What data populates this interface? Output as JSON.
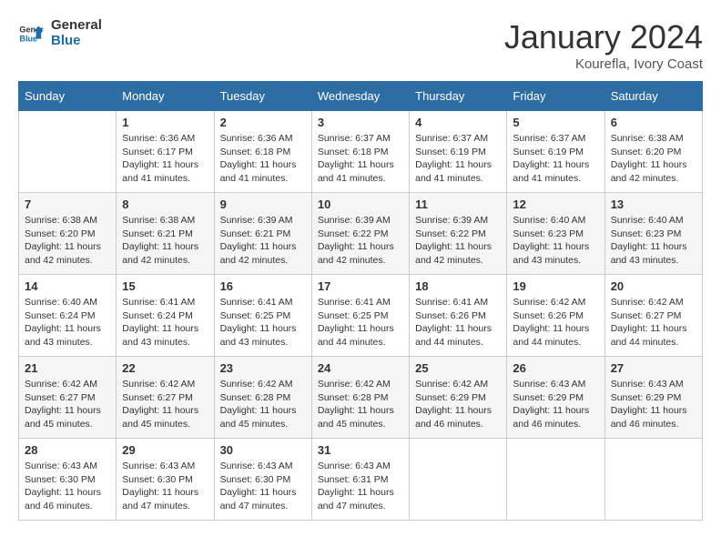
{
  "header": {
    "logo": "GeneralBlue",
    "month": "January 2024",
    "location": "Kourefla, Ivory Coast"
  },
  "days_of_week": [
    "Sunday",
    "Monday",
    "Tuesday",
    "Wednesday",
    "Thursday",
    "Friday",
    "Saturday"
  ],
  "weeks": [
    [
      {
        "day": "",
        "info": ""
      },
      {
        "day": "1",
        "info": "Sunrise: 6:36 AM\nSunset: 6:17 PM\nDaylight: 11 hours and 41 minutes."
      },
      {
        "day": "2",
        "info": "Sunrise: 6:36 AM\nSunset: 6:18 PM\nDaylight: 11 hours and 41 minutes."
      },
      {
        "day": "3",
        "info": "Sunrise: 6:37 AM\nSunset: 6:18 PM\nDaylight: 11 hours and 41 minutes."
      },
      {
        "day": "4",
        "info": "Sunrise: 6:37 AM\nSunset: 6:19 PM\nDaylight: 11 hours and 41 minutes."
      },
      {
        "day": "5",
        "info": "Sunrise: 6:37 AM\nSunset: 6:19 PM\nDaylight: 11 hours and 41 minutes."
      },
      {
        "day": "6",
        "info": "Sunrise: 6:38 AM\nSunset: 6:20 PM\nDaylight: 11 hours and 42 minutes."
      }
    ],
    [
      {
        "day": "7",
        "info": "Sunrise: 6:38 AM\nSunset: 6:20 PM\nDaylight: 11 hours and 42 minutes."
      },
      {
        "day": "8",
        "info": "Sunrise: 6:38 AM\nSunset: 6:21 PM\nDaylight: 11 hours and 42 minutes."
      },
      {
        "day": "9",
        "info": "Sunrise: 6:39 AM\nSunset: 6:21 PM\nDaylight: 11 hours and 42 minutes."
      },
      {
        "day": "10",
        "info": "Sunrise: 6:39 AM\nSunset: 6:22 PM\nDaylight: 11 hours and 42 minutes."
      },
      {
        "day": "11",
        "info": "Sunrise: 6:39 AM\nSunset: 6:22 PM\nDaylight: 11 hours and 42 minutes."
      },
      {
        "day": "12",
        "info": "Sunrise: 6:40 AM\nSunset: 6:23 PM\nDaylight: 11 hours and 43 minutes."
      },
      {
        "day": "13",
        "info": "Sunrise: 6:40 AM\nSunset: 6:23 PM\nDaylight: 11 hours and 43 minutes."
      }
    ],
    [
      {
        "day": "14",
        "info": "Sunrise: 6:40 AM\nSunset: 6:24 PM\nDaylight: 11 hours and 43 minutes."
      },
      {
        "day": "15",
        "info": "Sunrise: 6:41 AM\nSunset: 6:24 PM\nDaylight: 11 hours and 43 minutes."
      },
      {
        "day": "16",
        "info": "Sunrise: 6:41 AM\nSunset: 6:25 PM\nDaylight: 11 hours and 43 minutes."
      },
      {
        "day": "17",
        "info": "Sunrise: 6:41 AM\nSunset: 6:25 PM\nDaylight: 11 hours and 44 minutes."
      },
      {
        "day": "18",
        "info": "Sunrise: 6:41 AM\nSunset: 6:26 PM\nDaylight: 11 hours and 44 minutes."
      },
      {
        "day": "19",
        "info": "Sunrise: 6:42 AM\nSunset: 6:26 PM\nDaylight: 11 hours and 44 minutes."
      },
      {
        "day": "20",
        "info": "Sunrise: 6:42 AM\nSunset: 6:27 PM\nDaylight: 11 hours and 44 minutes."
      }
    ],
    [
      {
        "day": "21",
        "info": "Sunrise: 6:42 AM\nSunset: 6:27 PM\nDaylight: 11 hours and 45 minutes."
      },
      {
        "day": "22",
        "info": "Sunrise: 6:42 AM\nSunset: 6:27 PM\nDaylight: 11 hours and 45 minutes."
      },
      {
        "day": "23",
        "info": "Sunrise: 6:42 AM\nSunset: 6:28 PM\nDaylight: 11 hours and 45 minutes."
      },
      {
        "day": "24",
        "info": "Sunrise: 6:42 AM\nSunset: 6:28 PM\nDaylight: 11 hours and 45 minutes."
      },
      {
        "day": "25",
        "info": "Sunrise: 6:42 AM\nSunset: 6:29 PM\nDaylight: 11 hours and 46 minutes."
      },
      {
        "day": "26",
        "info": "Sunrise: 6:43 AM\nSunset: 6:29 PM\nDaylight: 11 hours and 46 minutes."
      },
      {
        "day": "27",
        "info": "Sunrise: 6:43 AM\nSunset: 6:29 PM\nDaylight: 11 hours and 46 minutes."
      }
    ],
    [
      {
        "day": "28",
        "info": "Sunrise: 6:43 AM\nSunset: 6:30 PM\nDaylight: 11 hours and 46 minutes."
      },
      {
        "day": "29",
        "info": "Sunrise: 6:43 AM\nSunset: 6:30 PM\nDaylight: 11 hours and 47 minutes."
      },
      {
        "day": "30",
        "info": "Sunrise: 6:43 AM\nSunset: 6:30 PM\nDaylight: 11 hours and 47 minutes."
      },
      {
        "day": "31",
        "info": "Sunrise: 6:43 AM\nSunset: 6:31 PM\nDaylight: 11 hours and 47 minutes."
      },
      {
        "day": "",
        "info": ""
      },
      {
        "day": "",
        "info": ""
      },
      {
        "day": "",
        "info": ""
      }
    ]
  ]
}
